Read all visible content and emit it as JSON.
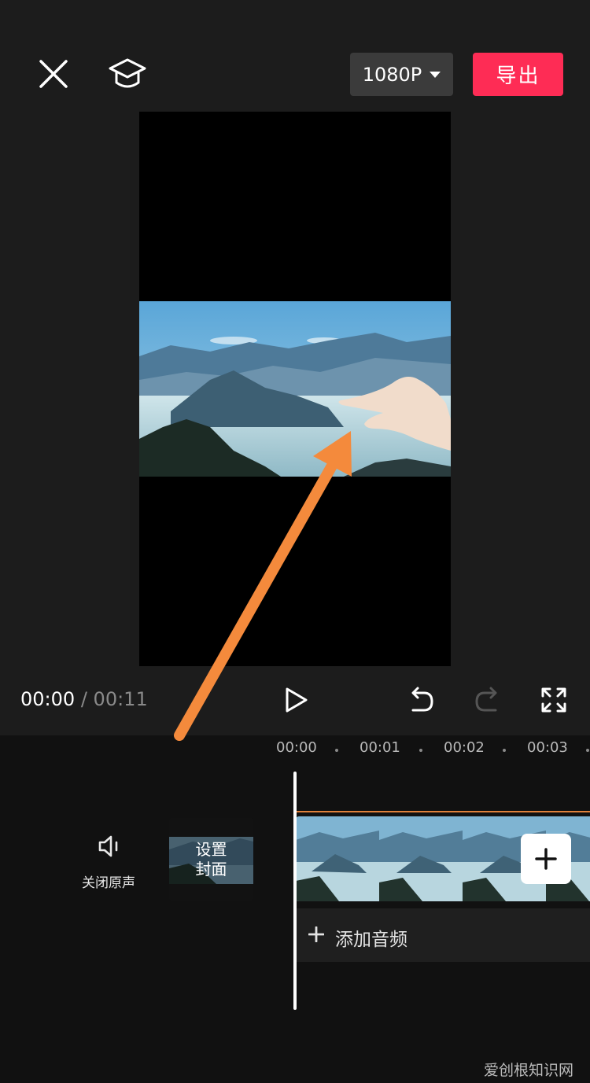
{
  "toolbar": {
    "close_icon": "close-icon",
    "tutorial_icon": "graduation-cap-icon",
    "resolution": "1080P",
    "export_label": "导出"
  },
  "playback": {
    "current_time": "00:00",
    "separator": "/",
    "total_time": "00:11"
  },
  "timeline": {
    "ruler": [
      "00:00",
      "00:01",
      "00:02",
      "00:03"
    ],
    "mute_label": "关闭原声",
    "cover_label_line1": "设置",
    "cover_label_line2": "封面",
    "add_audio_label": "添加音频"
  },
  "watermark": "爱创根知识网",
  "colors": {
    "accent": "#fe2c55",
    "clip_border": "#e0803a",
    "annotation_arrow": "#f48a3c"
  }
}
